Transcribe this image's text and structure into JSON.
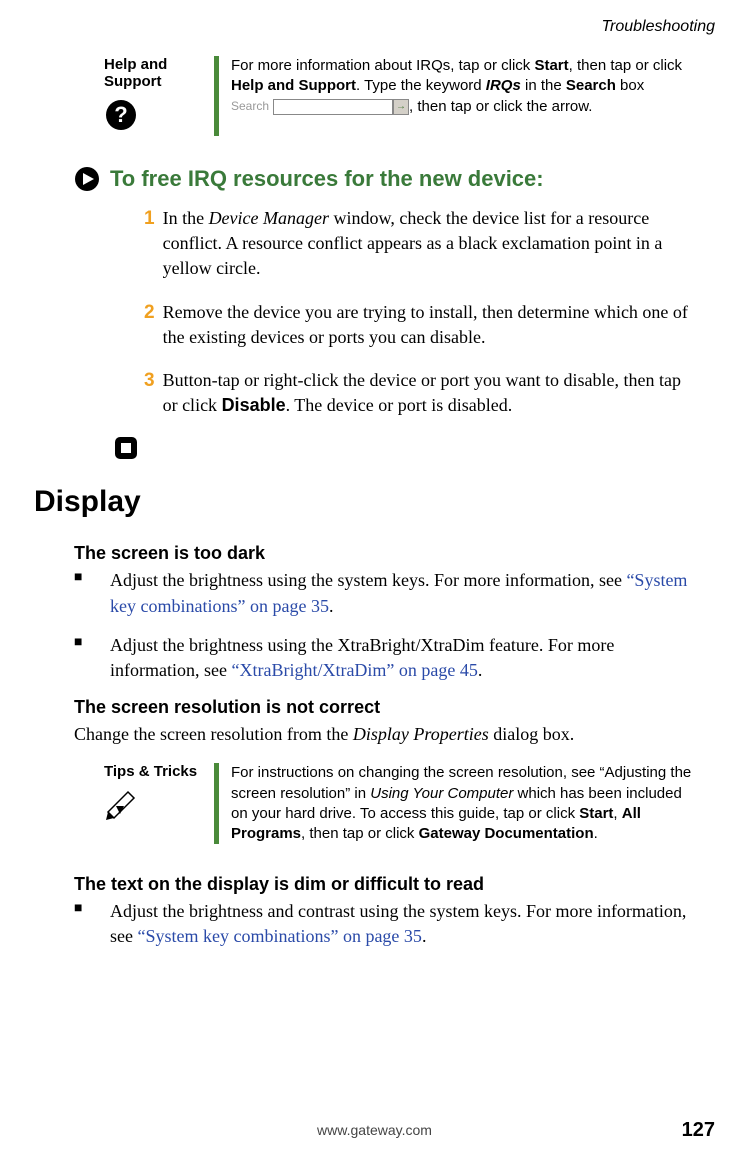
{
  "header": {
    "section": "Troubleshooting"
  },
  "help_callout": {
    "label": "Help and Support",
    "text_before": "For more information about IRQs, tap or click ",
    "bold1": "Start",
    "text_mid1": ", then tap or click ",
    "bold2": "Help and Support",
    "text_mid2": ". Type the keyword ",
    "bold_italic": "IRQs",
    "text_mid3": " in the ",
    "bold3": "Search",
    "text_mid4": " box ",
    "search_label": "Search",
    "text_after": ", then tap or click the arrow."
  },
  "procedure": {
    "heading": "To free IRQ resources for the new device:",
    "steps": [
      {
        "num": "1",
        "pre": "In the ",
        "italic": "Device Manager",
        "post": " window, check the device list for a resource conflict. A resource conflict appears as a black exclamation point in a yellow circle."
      },
      {
        "num": "2",
        "text": "Remove the device you are trying to install, then determine which one of the existing devices or ports you can disable."
      },
      {
        "num": "3",
        "pre": "Button-tap or right-click the device or port you want to disable, then tap or click ",
        "bold": "Disable",
        "post": ". The device or port is disabled."
      }
    ]
  },
  "display_section": {
    "heading": "Display",
    "dark": {
      "sub": "The screen is too dark",
      "b1_pre": "Adjust the brightness using the system keys. For more information, see ",
      "b1_link": "“System key combinations” on page 35",
      "b1_post": ".",
      "b2_pre": "Adjust the brightness using the XtraBright/XtraDim feature. For more information, see ",
      "b2_link": "“XtraBright/XtraDim” on page 45",
      "b2_post": "."
    },
    "res": {
      "sub": "The screen resolution is not correct",
      "body_pre": "Change the screen resolution from the ",
      "body_italic": "Display Properties",
      "body_post": " dialog box."
    },
    "tips": {
      "label": "Tips & Tricks",
      "t1": "For instructions on changing the screen resolution, see “Adjusting the screen resolution” in ",
      "t_italic": "Using Your Computer",
      "t2": " which has been included on your hard drive. To access this guide, tap or click ",
      "b1": "Start",
      "t3": ", ",
      "b2": "All Programs",
      "t4": ", then tap or click ",
      "b3": "Gateway Documentation",
      "t5": "."
    },
    "dim": {
      "sub": "The text on the display is dim or difficult to read",
      "b1_pre": "Adjust the brightness and contrast using the system keys. For more information, see ",
      "b1_link": "“System key combinations” on page 35",
      "b1_post": "."
    }
  },
  "footer": {
    "url": "www.gateway.com",
    "page": "127"
  }
}
